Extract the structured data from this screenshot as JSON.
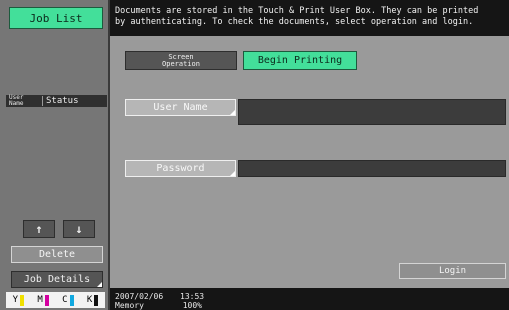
{
  "sidebar": {
    "job_list_label": "Job List",
    "header_user_line1": "User",
    "header_user_line2": "Name",
    "header_status": "Status",
    "up_arrow": "↑",
    "down_arrow": "↓",
    "delete_label": "Delete",
    "job_details_label": "Job Details",
    "toner": [
      {
        "letter": "Y",
        "color": "#f0e000"
      },
      {
        "letter": "M",
        "color": "#d400a0"
      },
      {
        "letter": "C",
        "color": "#10a8e0"
      },
      {
        "letter": "K",
        "color": "#111111"
      }
    ]
  },
  "message": {
    "line1": "Documents are stored in the Touch & Print User Box. They can be printed",
    "line2": "by authenticating. To check the documents, select operation and login."
  },
  "tabs": {
    "screen_operation_line1": "Screen",
    "screen_operation_line2": "Operation",
    "begin_printing": "Begin Printing"
  },
  "form": {
    "user_name_label": "User Name",
    "user_name_value": "",
    "password_label": "Password",
    "password_value": "",
    "login_label": "Login"
  },
  "status_bar": {
    "date": "2007/02/06",
    "time": "13:53",
    "memory_label": "Memory",
    "memory_value": "100%"
  }
}
